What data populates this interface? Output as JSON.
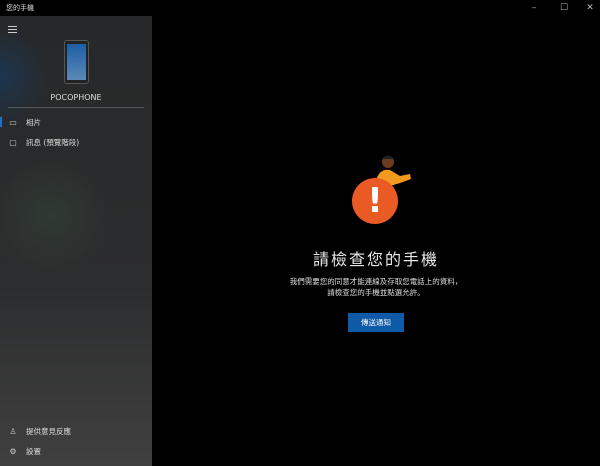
{
  "window": {
    "title": "您的手機",
    "minimize": "–",
    "maximize": "☐",
    "close": "✕"
  },
  "sidebar": {
    "menu_icon": "hamburger-icon",
    "device_name": "POCOPHONE",
    "items": [
      {
        "label": "相片",
        "icon": "photos-icon"
      },
      {
        "label": "訊息 (預覽階段)",
        "icon": "messages-icon"
      }
    ],
    "bottom": [
      {
        "label": "提供意見反應",
        "icon": "feedback-icon"
      },
      {
        "label": "設置",
        "icon": "gear-icon"
      }
    ]
  },
  "main": {
    "heading": "請檢查您的手機",
    "line1": "我們需要您的同意才能連線及存取您電話上的資料，",
    "line2": "請檢查您的手機並點選允許。",
    "button": "傳送通知",
    "alert_symbol": "!"
  },
  "colors": {
    "accent": "#0f5aa8",
    "alert": "#ea5a24"
  }
}
